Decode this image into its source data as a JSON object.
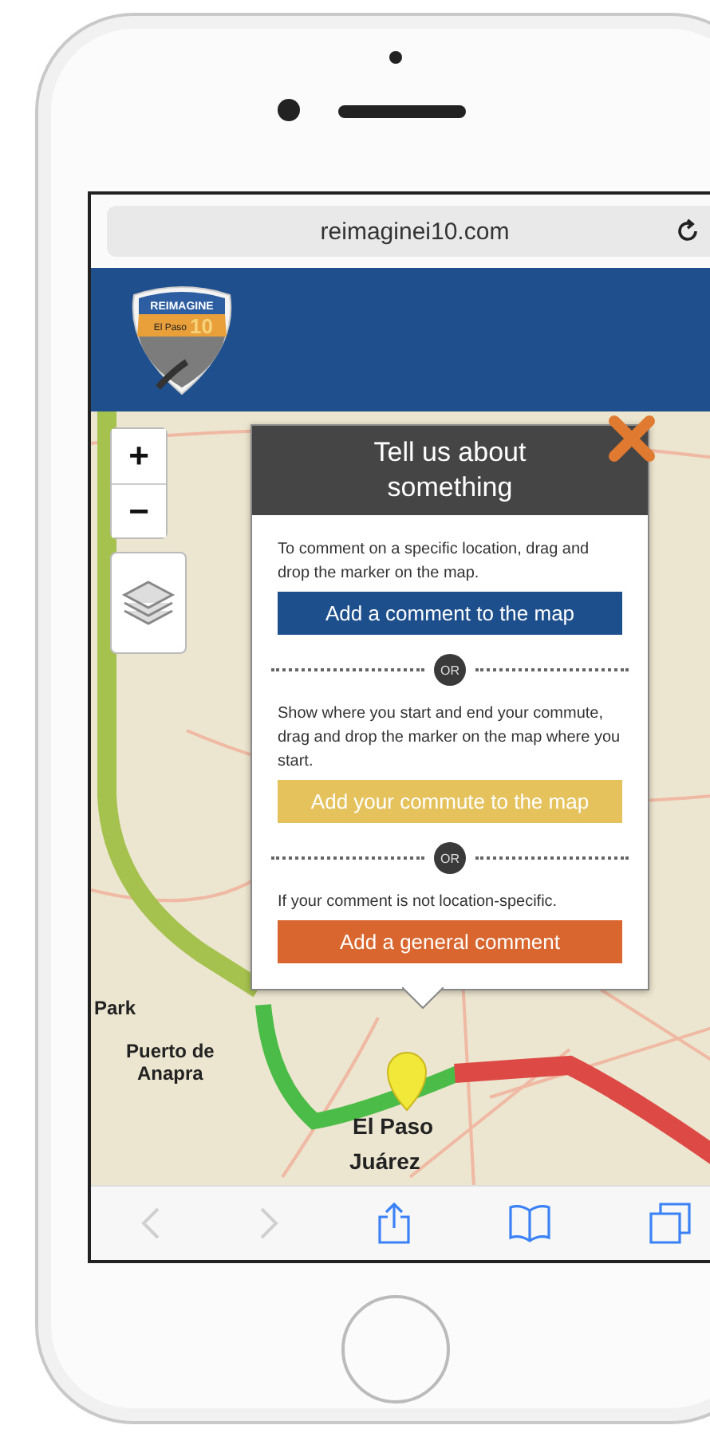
{
  "browser": {
    "url": "reimaginei10.com"
  },
  "header": {
    "logo": {
      "top": "REIMAGINE",
      "name": "El Paso",
      "number": "10"
    }
  },
  "map": {
    "zoom_in": "+",
    "zoom_out": "−",
    "labels": [
      {
        "text": "Park",
        "kind": "place"
      },
      {
        "text": "Puerto de\nAnapra",
        "kind": "place"
      },
      {
        "text": "El Paso",
        "kind": "city"
      },
      {
        "text": "Juárez",
        "kind": "city"
      }
    ]
  },
  "popup": {
    "title": "Tell us about something",
    "sections": [
      {
        "text": "To comment on a specific location, drag and drop the marker on the map.",
        "button": "Add a comment to the map",
        "color": "#1d4f8c"
      },
      {
        "separator": "OR",
        "text": "Show where you start and end your commute, drag and drop the marker on the map where you start.",
        "button": "Add your commute to the map",
        "color": "#e6c25c"
      },
      {
        "separator": "OR",
        "text": "If your comment is not location-specific.",
        "button": "Add a general comment",
        "color": "#d9662e"
      }
    ]
  },
  "toolbar": [
    {
      "kind": "back",
      "disabled": true
    },
    {
      "kind": "forward",
      "disabled": true
    },
    {
      "kind": "share",
      "disabled": false
    },
    {
      "kind": "bookmarks",
      "disabled": false
    },
    {
      "kind": "tabs",
      "disabled": false
    }
  ]
}
